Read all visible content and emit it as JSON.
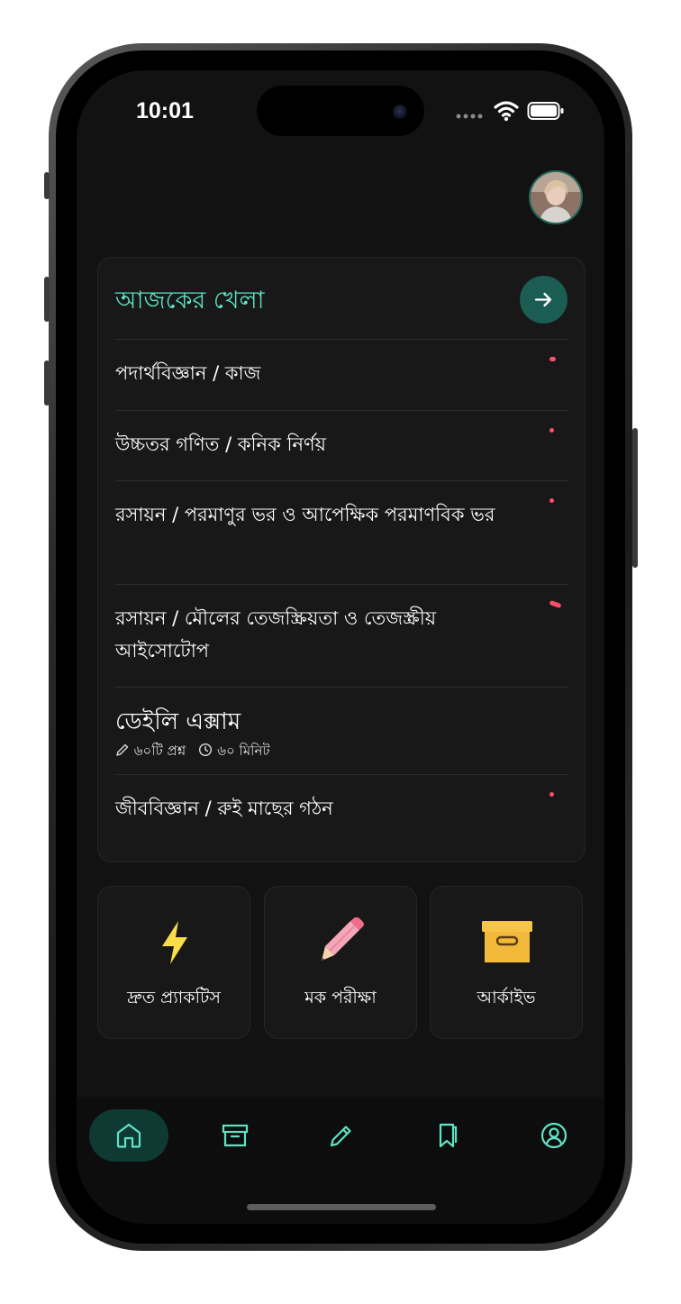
{
  "status_bar": {
    "time": "10:01",
    "icons": [
      "signal-dots-icon",
      "wifi-icon",
      "battery-icon"
    ]
  },
  "profile": {
    "avatar": "avatar-photo"
  },
  "today_card": {
    "title": "আজকের খেলা",
    "open_icon": "arrow-right-icon",
    "items": [
      {
        "text": "পদার্থবিজ্ঞান / কাজ"
      },
      {
        "text": "উচ্চতর গণিত / কনিক নির্ণয়"
      },
      {
        "text": "রসায়ন / পরমাণুর ভর ও আপেক্ষিক পরমাণবিক ভর"
      },
      {
        "text": "রসায়ন / মৌলের তেজস্ক্রিয়তা ও তেজস্ক্রীয় আইসোটোপ"
      }
    ],
    "exam": {
      "title": "ডেইলি এক্সাম",
      "questions": "৬০টি প্রশ্ন",
      "duration": "৬০ মিনিট"
    },
    "last_item": {
      "text": "জীববিজ্ঞান /  রুই মাছের গঠন"
    }
  },
  "quick_actions": [
    {
      "label": "দ্রুত প্র্যাকটিস",
      "icon": "lightning-icon"
    },
    {
      "label": "মক পরীক্ষা",
      "icon": "pencil-icon"
    },
    {
      "label": "আর্কাইভ",
      "icon": "archive-box-icon"
    }
  ],
  "tab_bar": {
    "tabs": [
      "home-icon",
      "archive-icon",
      "pencil-icon",
      "bookmark-icon",
      "profile-icon"
    ],
    "active": "home-icon"
  },
  "colors": {
    "accent": "#5fe3c4",
    "accent_dark": "#1b5d52",
    "background": "#121212",
    "card": "#181818",
    "indicator": "#ff4d6d"
  }
}
